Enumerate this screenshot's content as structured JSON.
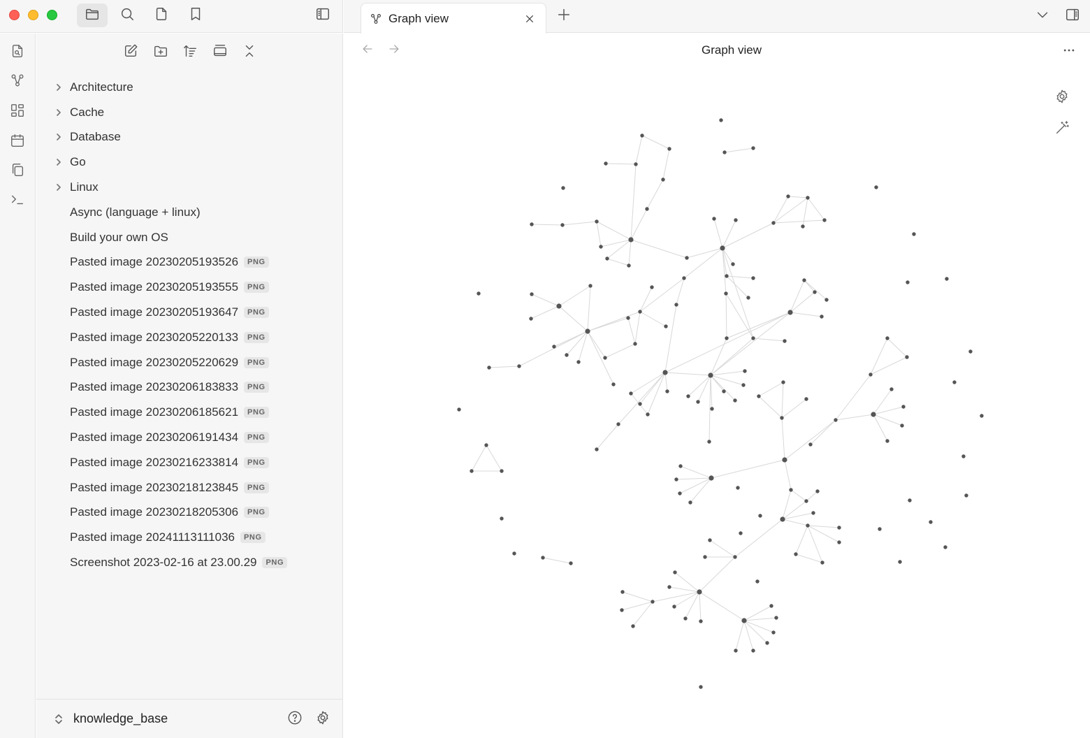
{
  "tab": {
    "label": "Graph view"
  },
  "view": {
    "title": "Graph view"
  },
  "explorer": {
    "items": [
      {
        "name": "Architecture",
        "folder": true,
        "ext": ""
      },
      {
        "name": "Cache",
        "folder": true,
        "ext": ""
      },
      {
        "name": "Database",
        "folder": true,
        "ext": ""
      },
      {
        "name": "Go",
        "folder": true,
        "ext": ""
      },
      {
        "name": "Linux",
        "folder": true,
        "ext": ""
      },
      {
        "name": "Async (language + linux)",
        "folder": false,
        "ext": ""
      },
      {
        "name": "Build your own OS",
        "folder": false,
        "ext": ""
      },
      {
        "name": "Pasted image 20230205193526",
        "folder": false,
        "ext": "PNG"
      },
      {
        "name": "Pasted image 20230205193555",
        "folder": false,
        "ext": "PNG"
      },
      {
        "name": "Pasted image 20230205193647",
        "folder": false,
        "ext": "PNG"
      },
      {
        "name": "Pasted image 20230205220133",
        "folder": false,
        "ext": "PNG"
      },
      {
        "name": "Pasted image 20230205220629",
        "folder": false,
        "ext": "PNG"
      },
      {
        "name": "Pasted image 20230206183833",
        "folder": false,
        "ext": "PNG"
      },
      {
        "name": "Pasted image 20230206185621",
        "folder": false,
        "ext": "PNG"
      },
      {
        "name": "Pasted image 20230206191434",
        "folder": false,
        "ext": "PNG"
      },
      {
        "name": "Pasted image 20230216233814",
        "folder": false,
        "ext": "PNG"
      },
      {
        "name": "Pasted image 20230218123845",
        "folder": false,
        "ext": "PNG"
      },
      {
        "name": "Pasted image 20230218205306",
        "folder": false,
        "ext": "PNG"
      },
      {
        "name": "Pasted image 20241113111036",
        "folder": false,
        "ext": "PNG"
      },
      {
        "name": "Screenshot 2023-02-16 at 23.00.29",
        "folder": false,
        "ext": "PNG"
      }
    ]
  },
  "vault": {
    "name": "knowledge_base"
  },
  "icons": {
    "titlebar": [
      "folder-icon",
      "search-icon",
      "file-icon",
      "bookmark-icon",
      "sidebar-toggle-icon"
    ],
    "ribbon": [
      "quick-switcher-icon",
      "graph-icon",
      "canvas-icon",
      "calendar-icon",
      "copy-icon",
      "terminal-icon"
    ],
    "explorer_toolbar": [
      "new-note-icon",
      "new-folder-icon",
      "sort-icon",
      "auto-reveal-icon",
      "collapse-all-icon"
    ],
    "tabbar": [
      "new-tab-icon",
      "tab-list-chevron-icon",
      "right-sidebar-toggle-icon"
    ],
    "graph_controls": [
      "graph-settings-gear-icon",
      "animate-wand-icon"
    ]
  },
  "colors": {
    "traffic_red": "#fe5f57",
    "traffic_yellow": "#febc2e",
    "traffic_green": "#28c840",
    "graph_node": "#555555",
    "graph_edge": "#d8d8d8"
  }
}
